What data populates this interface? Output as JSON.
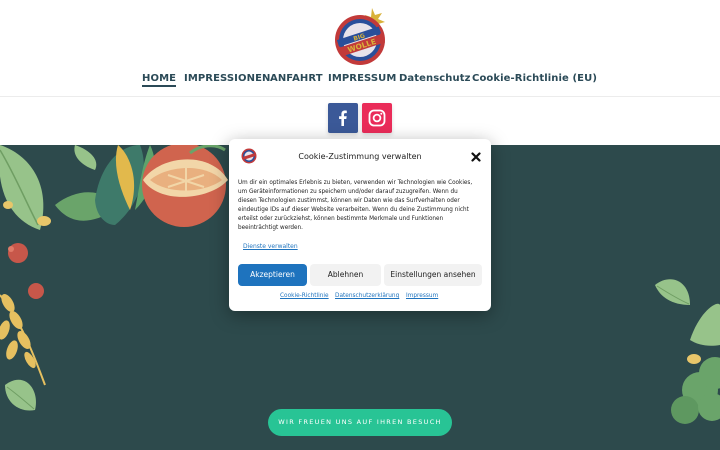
{
  "header": {
    "logo_text": "BIG WOLLE",
    "nav": [
      {
        "label": "HOME",
        "active": true
      },
      {
        "label": "IMPRESSIONEN"
      },
      {
        "label": "ANFAHRT"
      },
      {
        "label": "IMPRESSUM"
      },
      {
        "label": "Datenschutz"
      },
      {
        "label": "Cookie-Richtlinie (EU)"
      }
    ]
  },
  "social": [
    {
      "icon": "facebook-icon",
      "color": "#3b5998"
    },
    {
      "icon": "instagram-icon",
      "color": "#ea2c59"
    }
  ],
  "hero": {
    "background": "#2d4a4c",
    "button_label": "WIR FREUEN UNS AUF IHREN BESUCH",
    "button_color": "#28c495"
  },
  "cookie_modal": {
    "title": "Cookie-Zustimmung verwalten",
    "body": "Um dir ein optimales Erlebnis zu bieten, verwenden wir Technologien wie Cookies, um Geräteinformationen zu speichern und/oder darauf zuzugreifen. Wenn du diesen Technologien zustimmst, können wir Daten wie das Surfverhalten oder eindeutige IDs auf dieser Website verarbeiten. Wenn du deine Zustimmung nicht erteilst oder zurückziehst, können bestimmte Merkmale und Funktionen beeinträchtigt werden.",
    "manage_link": "Dienste verwalten",
    "accept_label": "Akzeptieren",
    "deny_label": "Ablehnen",
    "settings_label": "Einstellungen ansehen",
    "footer_links": [
      "Cookie-Richtlinie",
      "Datenschutzerklärung",
      "Impressum"
    ],
    "accent_color": "#1e73be"
  }
}
